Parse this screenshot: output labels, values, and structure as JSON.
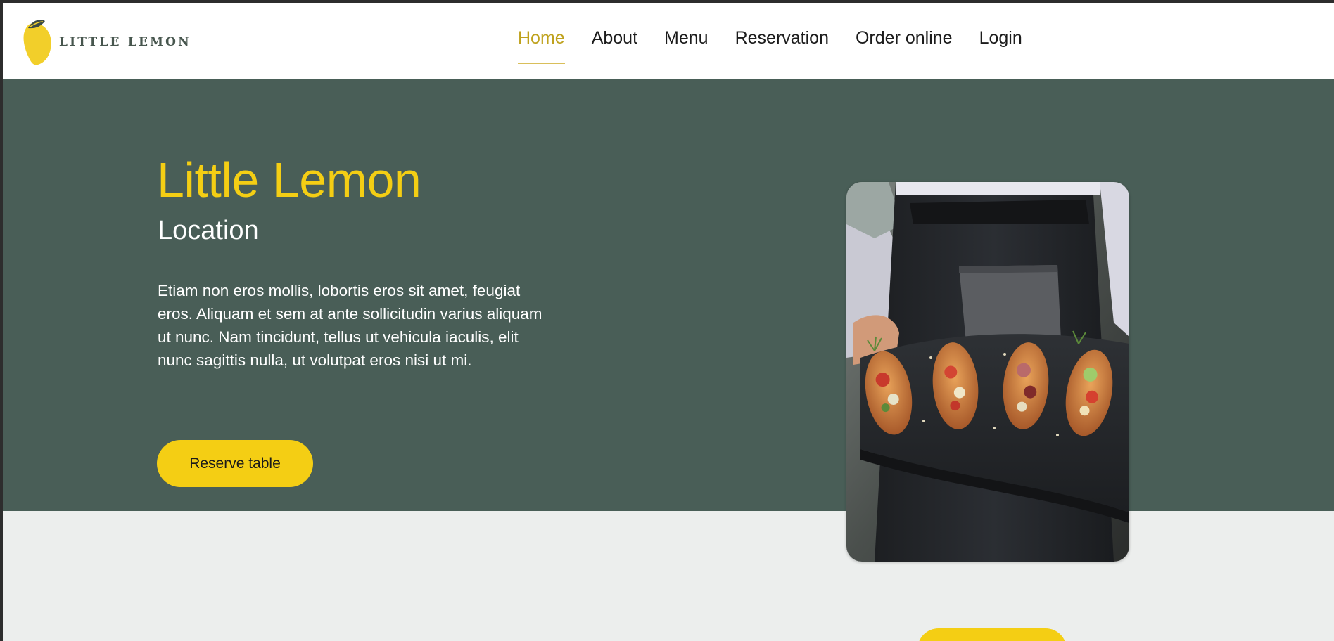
{
  "brand": {
    "name": "LITTLE LEMON"
  },
  "nav": {
    "items": [
      {
        "label": "Home",
        "active": true
      },
      {
        "label": "About"
      },
      {
        "label": "Menu"
      },
      {
        "label": "Reservation"
      },
      {
        "label": "Order online"
      },
      {
        "label": "Login"
      }
    ]
  },
  "hero": {
    "title": "Little Lemon",
    "subtitle": "Location",
    "description": "Etiam non eros mollis, lobortis eros sit amet, feugiat eros. Aliquam et sem at ante sollicitudin varius aliquam ut nunc. Nam tincidunt, tellus ut vehicula iaculis, elit nunc sagittis nulla, ut volutpat eros nisi ut mi.",
    "button_label": "Reserve table"
  },
  "colors": {
    "primary_green": "#495e57",
    "primary_yellow": "#f4ce14",
    "background_light": "#eceeed"
  }
}
